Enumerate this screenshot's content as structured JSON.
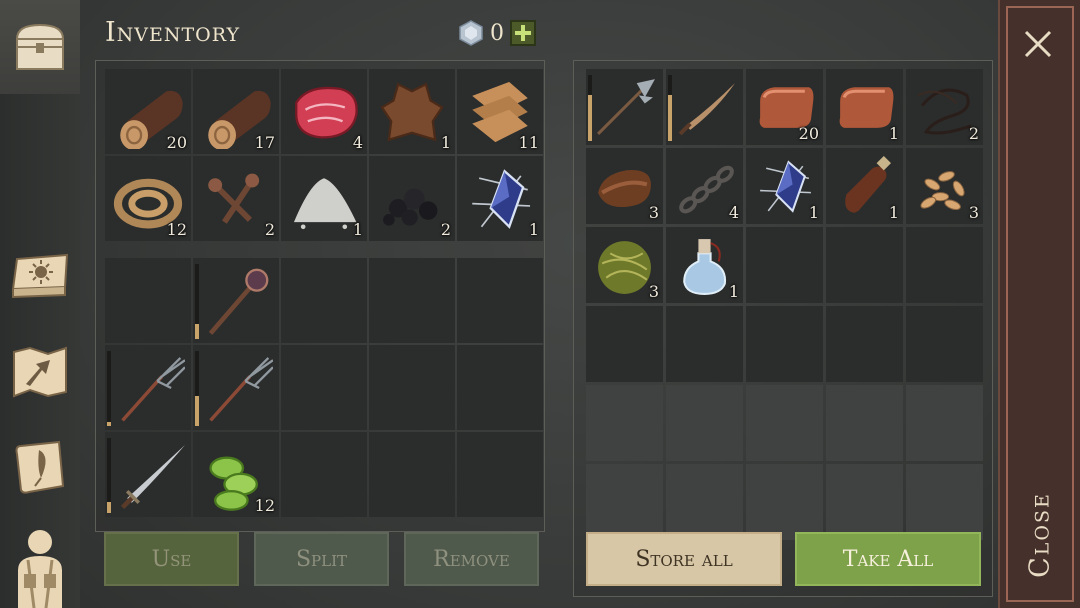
{
  "title": "Inventory",
  "currency": {
    "value": "0",
    "icon": "gem-icon",
    "plus": "+"
  },
  "buttons": {
    "use": "Use",
    "split": "Split",
    "remove": "Remove",
    "store_all": "Store all",
    "take_all": "Take All",
    "close": "Close"
  },
  "sidebar": [
    "chest-icon",
    "skills-book-icon",
    "map-icon",
    "recipes-scroll-icon",
    "character-icon"
  ],
  "inventory_items": [
    {
      "icon": "wood-log-icon",
      "count": "20"
    },
    {
      "icon": "wood-log-icon",
      "count": "17"
    },
    {
      "icon": "raw-meat-icon",
      "count": "4"
    },
    {
      "icon": "hide-icon",
      "count": "1"
    },
    {
      "icon": "cloth-icon",
      "count": "11"
    },
    {
      "icon": "rope-icon",
      "count": "12"
    },
    {
      "icon": "nails-icon",
      "count": "2"
    },
    {
      "icon": "salt-pile-icon",
      "count": "1"
    },
    {
      "icon": "coal-icon",
      "count": "2"
    },
    {
      "icon": "energy-crystal-icon",
      "count": "1"
    }
  ],
  "equipment": [
    {
      "icon": "",
      "count": "",
      "durability": null
    },
    {
      "icon": "mace-icon",
      "count": "",
      "durability": 0.2
    },
    {
      "icon": "",
      "count": "",
      "durability": null
    },
    {
      "icon": "",
      "count": "",
      "durability": null
    },
    {
      "icon": "",
      "count": "",
      "durability": null
    },
    {
      "icon": "pitchfork-icon",
      "count": "",
      "durability": 0.05
    },
    {
      "icon": "pitchfork-icon",
      "count": "",
      "durability": 0.4
    },
    {
      "icon": "",
      "count": "",
      "durability": null
    },
    {
      "icon": "",
      "count": "",
      "durability": null
    },
    {
      "icon": "",
      "count": "",
      "durability": null
    },
    {
      "icon": "sword-icon",
      "count": "",
      "durability": 0.15
    },
    {
      "icon": "cucumber-icon",
      "count": "12",
      "durability": null
    },
    {
      "icon": "",
      "count": "",
      "durability": null
    },
    {
      "icon": "",
      "count": "",
      "durability": null
    },
    {
      "icon": "",
      "count": "",
      "durability": null
    }
  ],
  "chest_items": [
    {
      "icon": "halberd-icon",
      "count": "",
      "durability": 0.7
    },
    {
      "icon": "saber-icon",
      "count": "",
      "durability": 0.7
    },
    {
      "icon": "copper-ingot-icon",
      "count": "20"
    },
    {
      "icon": "copper-ingot-icon",
      "count": "1"
    },
    {
      "icon": "sinew-icon",
      "count": "2"
    },
    {
      "icon": "leather-icon",
      "count": "3"
    },
    {
      "icon": "chain-icon",
      "count": "4"
    },
    {
      "icon": "energy-crystal-icon",
      "count": "1"
    },
    {
      "icon": "bottle-icon",
      "count": "1"
    },
    {
      "icon": "seeds-icon",
      "count": "3"
    },
    {
      "icon": "grass-bundle-icon",
      "count": "3"
    },
    {
      "icon": "water-flask-icon",
      "count": "1"
    }
  ]
}
